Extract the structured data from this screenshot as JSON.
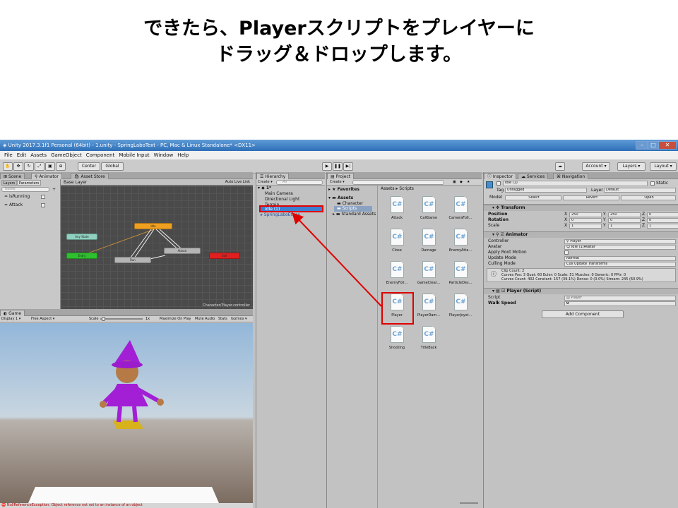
{
  "slide": {
    "title_line1": "できたら、Playerスクリプトをプレイヤーに",
    "title_line2": "ドラッグ＆ドロップします。"
  },
  "window": {
    "title": "Unity 2017.3.1f1 Personal (64bit) - 1.unity - SpringLaboText - PC, Mac & Linux Standalone* <DX11>"
  },
  "menu": [
    "File",
    "Edit",
    "Assets",
    "GameObject",
    "Component",
    "Mobile Input",
    "Window",
    "Help"
  ],
  "toolbar": {
    "center": "Center",
    "global": "Global",
    "account": "Account",
    "layers": "Layers",
    "layout": "Layout"
  },
  "animator": {
    "tabs": {
      "scene": "Scene",
      "animator": "Animator",
      "asset_store": "Asset Store"
    },
    "subtabs": {
      "layers": "Layers",
      "parameters": "Parameters"
    },
    "search_placeholder": "Name",
    "params": [
      {
        "name": "isRunning"
      },
      {
        "name": "Attack"
      }
    ],
    "base_layer": "Base Layer",
    "auto_live_link": "Auto Live Link",
    "footer_path": "Character/Player.controller",
    "nodes": {
      "any_state": "Any State",
      "entry": "Entry",
      "exit": "Exit",
      "idle": "Idle",
      "run": "Run",
      "attack": "Attack"
    }
  },
  "game": {
    "tab": "Game",
    "display": "Display 1",
    "aspect": "Free Aspect",
    "scale_label": "Scale",
    "scale_value": "1x",
    "maximize": "Maximize On Play",
    "mute": "Mute Audio",
    "stats": "Stats",
    "gizmos": "Gizmos",
    "error": "NullReferenceException: Object reference not set to an instance of an object"
  },
  "hierarchy": {
    "tab": "Hierarchy",
    "create": "Create",
    "search_placeholder": "All",
    "scene": "1*",
    "items": [
      {
        "label": "Main Camera"
      },
      {
        "label": "Directional Light"
      },
      {
        "label": "Terrain"
      },
      {
        "label": "Idle (1)"
      },
      {
        "label": "SpringLaboEthan"
      }
    ]
  },
  "project": {
    "tab": "Project",
    "create": "Create",
    "breadcrumb": "Assets ▸ Scripts",
    "favorites": "Favorites",
    "tree": [
      {
        "label": "Assets"
      },
      {
        "label": "Character"
      },
      {
        "label": "Scripts"
      },
      {
        "label": "Standard Assets"
      }
    ],
    "scripts": [
      {
        "label": "Attack"
      },
      {
        "label": "CallGame"
      },
      {
        "label": "CameraFoll..."
      },
      {
        "label": "Close"
      },
      {
        "label": "Damage"
      },
      {
        "label": "EnemyAtta..."
      },
      {
        "label": "EnemyFoll..."
      },
      {
        "label": "GameClear..."
      },
      {
        "label": "ParticleDes..."
      },
      {
        "label": "Player"
      },
      {
        "label": "PlayerDam..."
      },
      {
        "label": "PlayerJoyst..."
      },
      {
        "label": "Shooting"
      },
      {
        "label": "TitleBack"
      }
    ],
    "script_icon": "C#"
  },
  "inspector": {
    "tabs": {
      "inspector": "Inspector",
      "services": "Services",
      "navigation": "Navigation"
    },
    "object_name": "Idle (1)",
    "static": "Static",
    "tag_label": "Tag",
    "tag_value": "Untagged",
    "layer_label": "Layer",
    "layer_value": "Default",
    "model_label": "Model",
    "select": "Select",
    "revert": "Revert",
    "open": "Open",
    "transform": {
      "title": "Transform",
      "rows": [
        {
          "label": "Position",
          "x": "250",
          "y": "250",
          "z": "0"
        },
        {
          "label": "Rotation",
          "x": "0",
          "y": "0",
          "z": "0"
        },
        {
          "label": "Scale",
          "x": "1",
          "y": "1",
          "z": "1"
        }
      ]
    },
    "animator": {
      "title": "Animator",
      "controller_label": "Controller",
      "controller_value": "Player",
      "avatar_label": "Avatar",
      "avatar_value": "Idle (1)Avatar",
      "root_motion_label": "Apply Root Motion",
      "update_mode_label": "Update Mode",
      "update_mode_value": "Normal",
      "culling_label": "Culling Mode",
      "culling_value": "Cull Update Transforms",
      "info_line1": "Clip Count: 2",
      "info_line2": "Curves Pos: 3 Quat: 60 Euler: 0 Scale: 51 Muscles: 0 Generic: 0 PPtr: 0",
      "info_line3": "Curves Count: 402 Constant: 157 (39.1%) Dense: 0 (0.0%) Stream: 245 (60.9%)"
    },
    "player_script": {
      "title": "Player (Script)",
      "script_label": "Script",
      "script_value": "Player",
      "walk_speed_label": "Walk Speed",
      "walk_speed_value": "0"
    },
    "add_component": "Add Component"
  },
  "colors": {
    "highlight": "#e00000",
    "title_bar": "#3a7bc4",
    "character_purple": "#a21fd6",
    "node_orange": "#f0a020",
    "node_green": "#2ec02e",
    "node_red": "#e02020",
    "node_teal": "#8fd0c0"
  }
}
